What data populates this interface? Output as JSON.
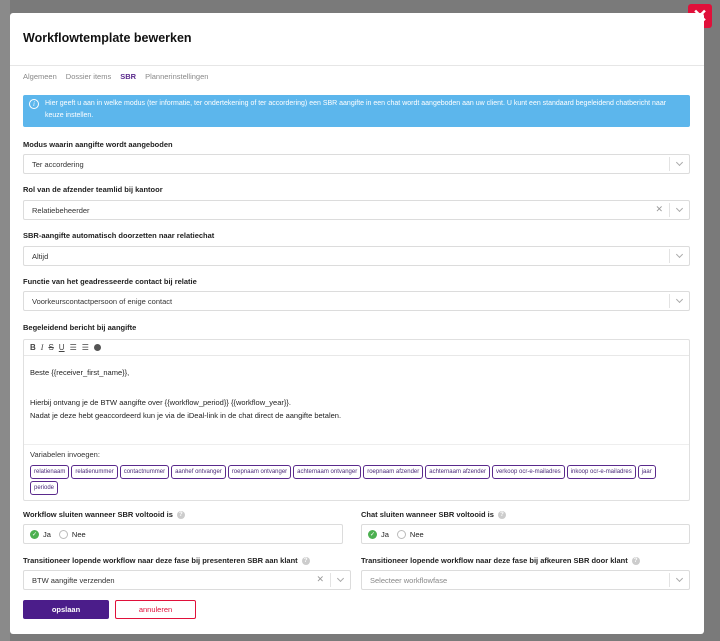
{
  "modal": {
    "title": "Workflowtemplate bewerken",
    "close_label": "✕",
    "tabs": [
      "Algemeen",
      "Dossier items",
      "SBR",
      "Plannerinstellingen"
    ],
    "info_text": "Hier geeft u aan in welke modus (ter informatie, ter ondertekening of ter accordering) een SBR aangifte in een chat wordt aangeboden aan uw client. U kunt een standaard begeleidend chatbericht naar keuze instellen."
  },
  "fields": {
    "modus": {
      "label": "Modus waarin aangifte wordt aangeboden",
      "value": "Ter accordering"
    },
    "rol": {
      "label": "Rol van de afzender teamlid bij kantoor",
      "value": "Relatiebeheerder"
    },
    "doorzetten": {
      "label": "SBR-aangifte automatisch doorzetten naar relatiechat",
      "value": "Altijd"
    },
    "functie": {
      "label": "Functie van het geadresseerde contact bij relatie",
      "value": "Voorkeurscontactpersoon of enige contact"
    },
    "bericht": {
      "label": "Begeleidend bericht bij aangifte",
      "toolbar": [
        "B",
        "I",
        "S",
        "U"
      ],
      "line1": "Beste {{receiver_first_name}},",
      "line2": "Hierbij ontvang je de BTW aangifte over {{workflow_period}} {{workflow_year}}.",
      "line3": "Nadat je deze hebt geaccordeerd kun je via de iDeal-link in de chat direct de aangifte betalen.",
      "variables_title": "Variabelen invoegen:",
      "variables": [
        "relatienaam",
        "relatienummer",
        "contactnummer",
        "aanhef ontvanger",
        "roepnaam ontvanger",
        "achternaam ontvanger",
        "roepnaam afzender",
        "achternaam afzender",
        "verkoop ocr-e-mailadres",
        "inkoop ocr-e-mailadres",
        "jaar",
        "periode"
      ]
    },
    "workflow_sluiten": {
      "label": "Workflow sluiten wanneer SBR voltooid is",
      "yes": "Ja",
      "no": "Nee"
    },
    "chat_sluiten": {
      "label": "Chat sluiten wanneer SBR voltooid is",
      "yes": "Ja",
      "no": "Nee"
    },
    "fase_presenteren": {
      "label": "Transitioneer lopende workflow naar deze fase bij presenteren SBR aan klant",
      "value": "BTW aangifte verzenden"
    },
    "fase_afkeuren": {
      "label": "Transitioneer lopende workflow naar deze fase bij afkeuren SBR door klant",
      "placeholder": "Selecteer workflowfase"
    }
  },
  "buttons": {
    "save": "opslaan",
    "cancel": "annuleren"
  },
  "colors": {
    "accent": "#4b1d8a",
    "danger": "#e0103a",
    "info": "#5cb6ec",
    "success": "#4cb050"
  }
}
